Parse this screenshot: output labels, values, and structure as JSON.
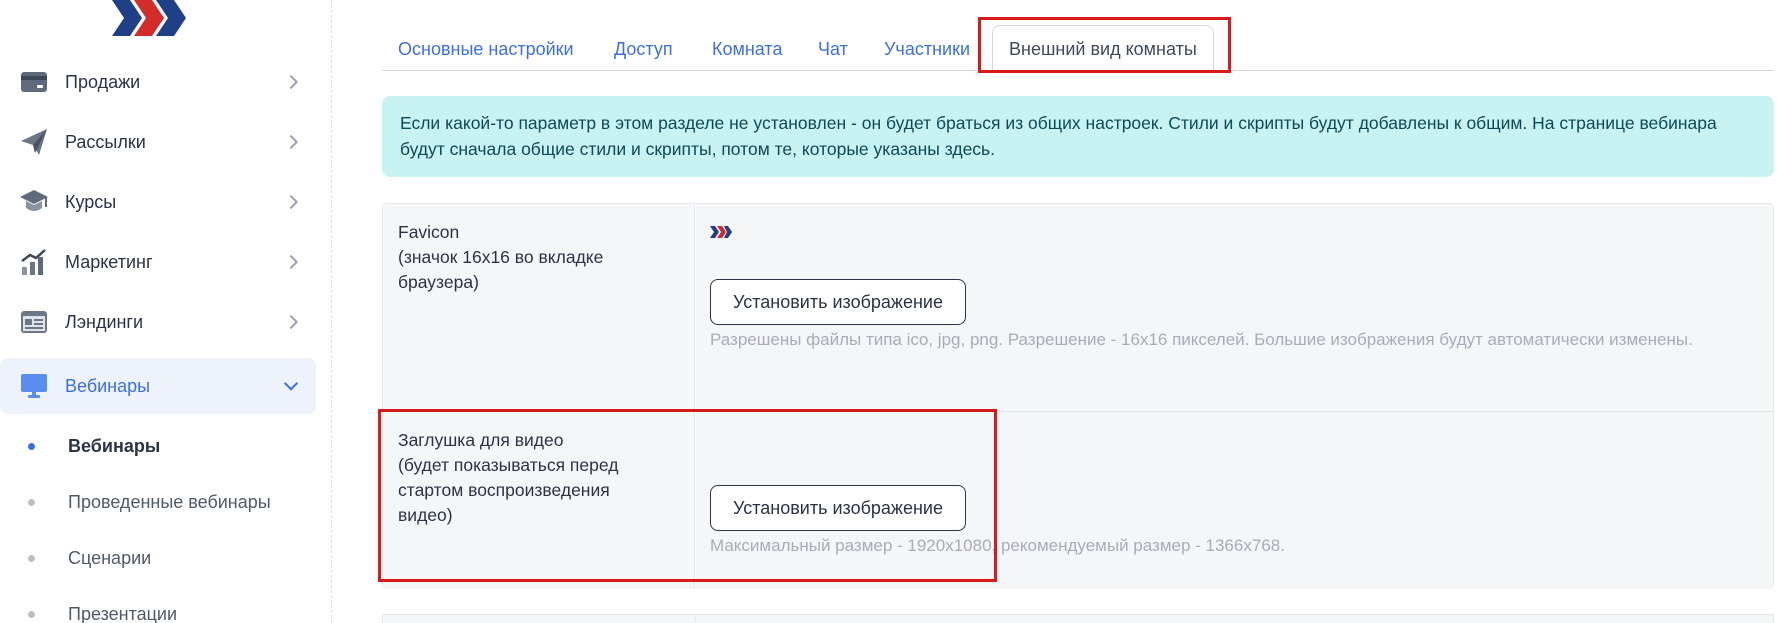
{
  "sidebar": {
    "logo": "logo-chevrons",
    "items": [
      {
        "label": "Продажи",
        "icon": "wallet-icon"
      },
      {
        "label": "Рассылки",
        "icon": "paper-plane-icon"
      },
      {
        "label": "Курсы",
        "icon": "graduation-cap-icon"
      },
      {
        "label": "Маркетинг",
        "icon": "growth-chart-icon"
      },
      {
        "label": "Лэндинги",
        "icon": "landing-page-icon"
      },
      {
        "label": "Вебинары",
        "icon": "monitor-icon",
        "active": true
      }
    ],
    "subitems": [
      {
        "label": "Вебинары",
        "active": true
      },
      {
        "label": "Проведенные вебинары"
      },
      {
        "label": "Сценарии"
      },
      {
        "label": "Презентации"
      }
    ]
  },
  "tabs": [
    {
      "label": "Основные настройки"
    },
    {
      "label": "Доступ"
    },
    {
      "label": "Комната"
    },
    {
      "label": "Чат"
    },
    {
      "label": "Участники"
    },
    {
      "label": "Внешний вид комнаты",
      "active": true
    }
  ],
  "alert": {
    "text": "Если какой-то параметр в этом разделе не установлен - он будет браться из общих настроек. Стили и скрипты будут добавлены к общим. На странице вебинара будут сначала общие стили и скрипты, потом те, которые указаны здесь."
  },
  "rows": [
    {
      "label_line1": "Favicon",
      "label_line2": "(значок 16x16 во вкладке браузера)",
      "button": "Установить изображение",
      "hint": "Разрешены файлы типа ico, jpg, png. Разрешение - 16x16 пикселей. Большие изображения будут автоматически изменены."
    },
    {
      "label_line1": "Заглушка для видео",
      "label_line2": "(будет показываться перед стартом воспроизведения видео)",
      "button": "Установить изображение",
      "hint": "Максимальный размер - 1920x1080, рекомендуемый размер - 1366x768."
    }
  ],
  "colors": {
    "accent": "#3d6fe0",
    "highlight": "#d91a1a",
    "alert_bg": "#c9f2f3",
    "brand_blue": "#1f3f86",
    "brand_red": "#d42b2b"
  }
}
